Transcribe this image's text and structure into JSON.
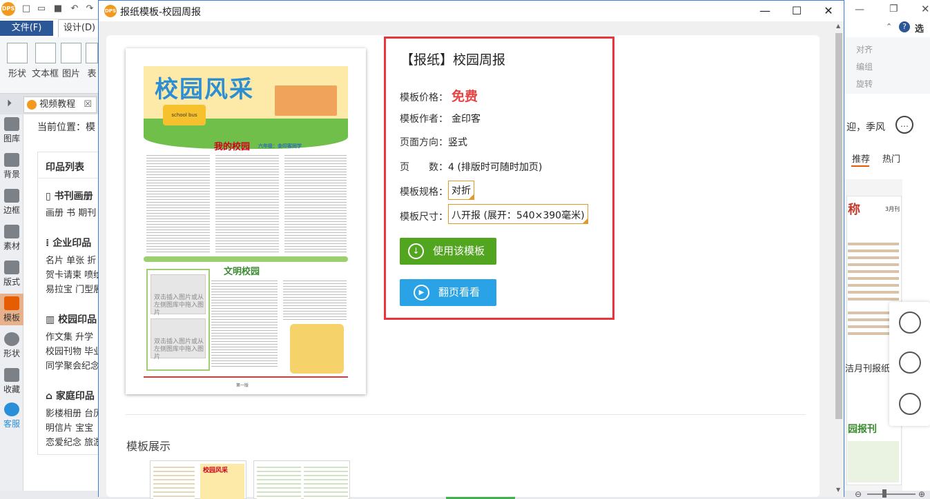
{
  "app": {
    "logo_text": "DPS",
    "tab_file": "文件(F)",
    "tab_design": "设计(D)",
    "ribbon_items": [
      "形状",
      "文本框",
      "图片",
      "表"
    ],
    "doc_tab": "视频教程",
    "doc_tab_close": "☒",
    "breadcrumb": "当前位置：模",
    "rail": [
      "图库",
      "背景",
      "边框",
      "素材",
      "版式",
      "模板",
      "形状",
      "收藏",
      "客服"
    ],
    "category_panel": {
      "title": "印品列表",
      "groups": [
        {
          "name": "书刊画册",
          "items": [
            "画册  书  期刊"
          ]
        },
        {
          "name": "企业印品",
          "items": [
            "名片  单张  折",
            "贺卡请柬  喷绘",
            "易拉宝  门型展"
          ]
        },
        {
          "name": "校园印品",
          "items": [
            "作文集  升学",
            "校园刊物  毕业",
            "同学聚会纪念"
          ]
        },
        {
          "name": "家庭印品",
          "items": [
            "影楼相册  台历",
            "明信片  宝宝",
            "恋爱纪念  旅游"
          ]
        }
      ]
    },
    "right_top": "选项",
    "right_ribbon": [
      "对齐",
      "编组",
      "旋转"
    ],
    "right_greeting": "迎，季风",
    "right_tabs": [
      "推荐",
      "热门"
    ],
    "right_snippets": [
      "称",
      "3月刊",
      "洁月刊报纸",
      "园报刊"
    ]
  },
  "dialog": {
    "logo_text": "DPS",
    "title": "报纸模板-校园周报",
    "win_min": "—",
    "win_max": "☐",
    "win_close": "✕"
  },
  "poster": {
    "title": "校园风采",
    "bus_text": "school bus",
    "section1_title": "我的校园",
    "section1_sub": "六年级：金印客同学",
    "section2_title": "文明校园",
    "placeholder_1": "双击插入图片或从左侧图库中拖入图片",
    "placeholder_2": "双击插入图片或从左侧图库中拖入图片",
    "footer": "第一版"
  },
  "template_info": {
    "heading": "【报纸】校园周报",
    "price_label": "模板价格：",
    "price_value": "免费",
    "author_label": "模板作者：",
    "author_value": "金印客",
    "orientation_label": "页面方向：",
    "orientation_value": "竖式",
    "pages_label": "页　　数：",
    "pages_value": "4 (排版时可随时加页)",
    "spec_label": "模板规格：",
    "spec_value": "对折",
    "size_label": "模板尺寸：",
    "size_value": "八开报 (展开：540×390毫米)",
    "use_button": "使用该模板",
    "flip_button": "翻页看看"
  },
  "showcase": {
    "label": "模板展示",
    "thumb_1_title": "校园风采"
  },
  "colors": {
    "accent_red": "#e8343a",
    "use_green": "#52a51f",
    "flip_blue": "#29a3e6",
    "price_red": "#e84343",
    "file_tab_blue": "#2b5797"
  }
}
